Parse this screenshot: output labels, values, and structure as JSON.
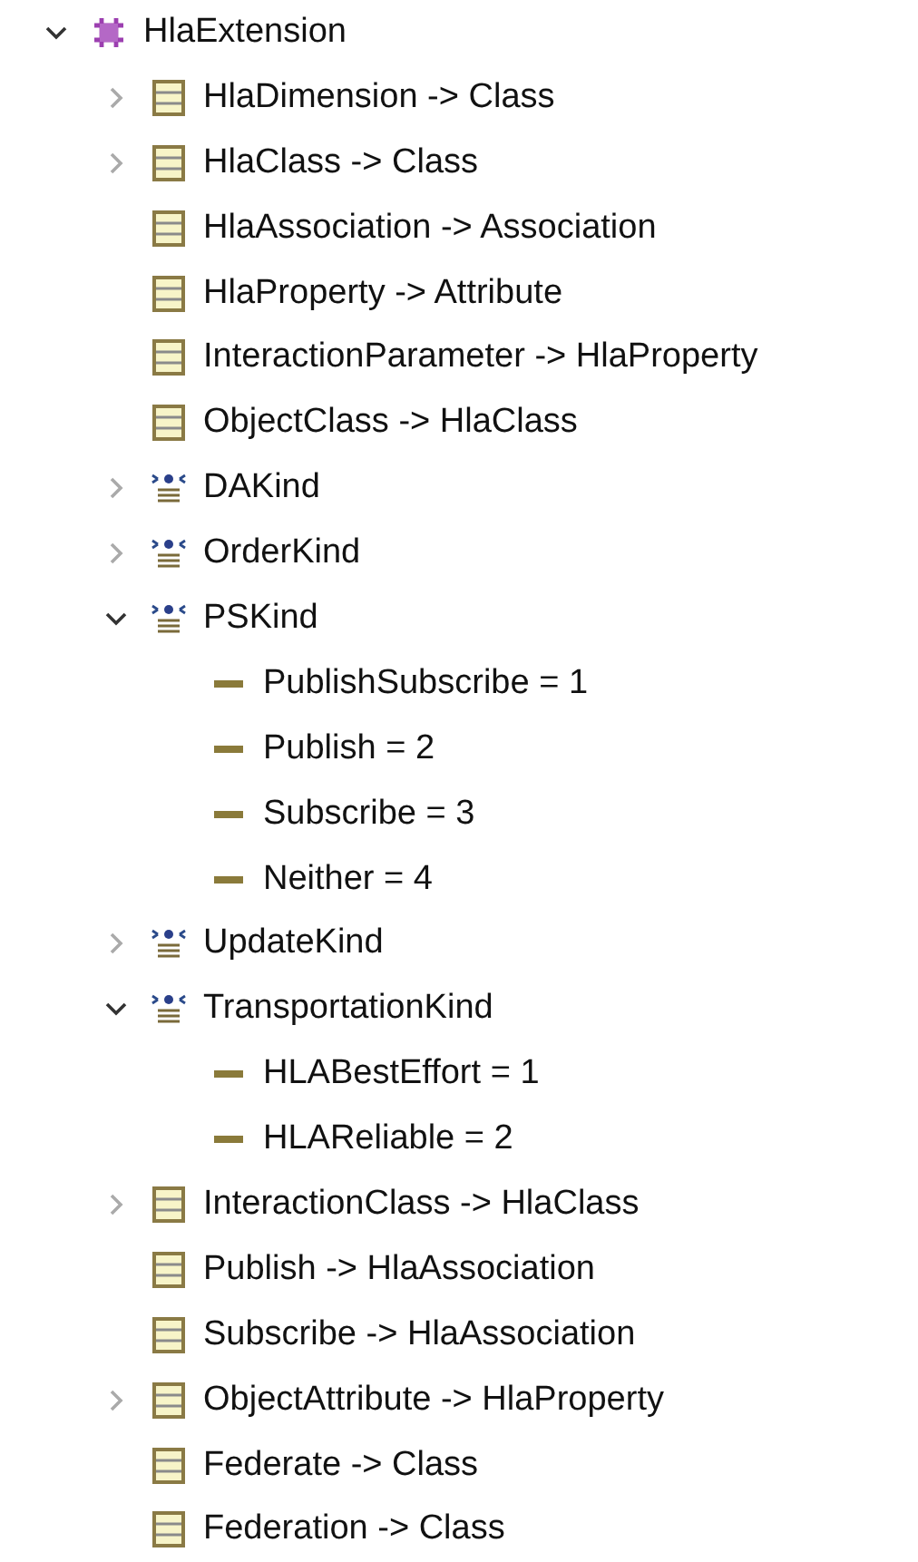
{
  "tree": [
    {
      "kind": "package",
      "label": "HlaExtension",
      "expanded": true,
      "children": [
        {
          "kind": "class",
          "label": "HlaDimension -> Class",
          "expanded": false
        },
        {
          "kind": "class",
          "label": "HlaClass -> Class",
          "expanded": false
        },
        {
          "kind": "class",
          "label": "HlaAssociation -> Association"
        },
        {
          "kind": "class",
          "label": "HlaProperty -> Attribute"
        },
        {
          "kind": "class",
          "label": "InteractionParameter -> HlaProperty"
        },
        {
          "kind": "class",
          "label": "ObjectClass -> HlaClass"
        },
        {
          "kind": "enumeration",
          "label": "DAKind",
          "expanded": false
        },
        {
          "kind": "enumeration",
          "label": "OrderKind",
          "expanded": false
        },
        {
          "kind": "enumeration",
          "label": "PSKind",
          "expanded": true,
          "children": [
            {
              "kind": "literal",
              "label": "PublishSubscribe = 1"
            },
            {
              "kind": "literal",
              "label": "Publish = 2"
            },
            {
              "kind": "literal",
              "label": "Subscribe = 3"
            },
            {
              "kind": "literal",
              "label": "Neither = 4"
            }
          ]
        },
        {
          "kind": "enumeration",
          "label": "UpdateKind",
          "expanded": false
        },
        {
          "kind": "enumeration",
          "label": "TransportationKind",
          "expanded": true,
          "children": [
            {
              "kind": "literal",
              "label": "HLABestEffort = 1"
            },
            {
              "kind": "literal",
              "label": "HLAReliable = 2"
            }
          ]
        },
        {
          "kind": "class",
          "label": "InteractionClass -> HlaClass",
          "expanded": false
        },
        {
          "kind": "class",
          "label": "Publish -> HlaAssociation"
        },
        {
          "kind": "class",
          "label": "Subscribe -> HlaAssociation"
        },
        {
          "kind": "class",
          "label": "ObjectAttribute -> HlaProperty",
          "expanded": false
        },
        {
          "kind": "class",
          "label": "Federate -> Class"
        },
        {
          "kind": "class",
          "label": "Federation -> Class"
        }
      ]
    }
  ]
}
